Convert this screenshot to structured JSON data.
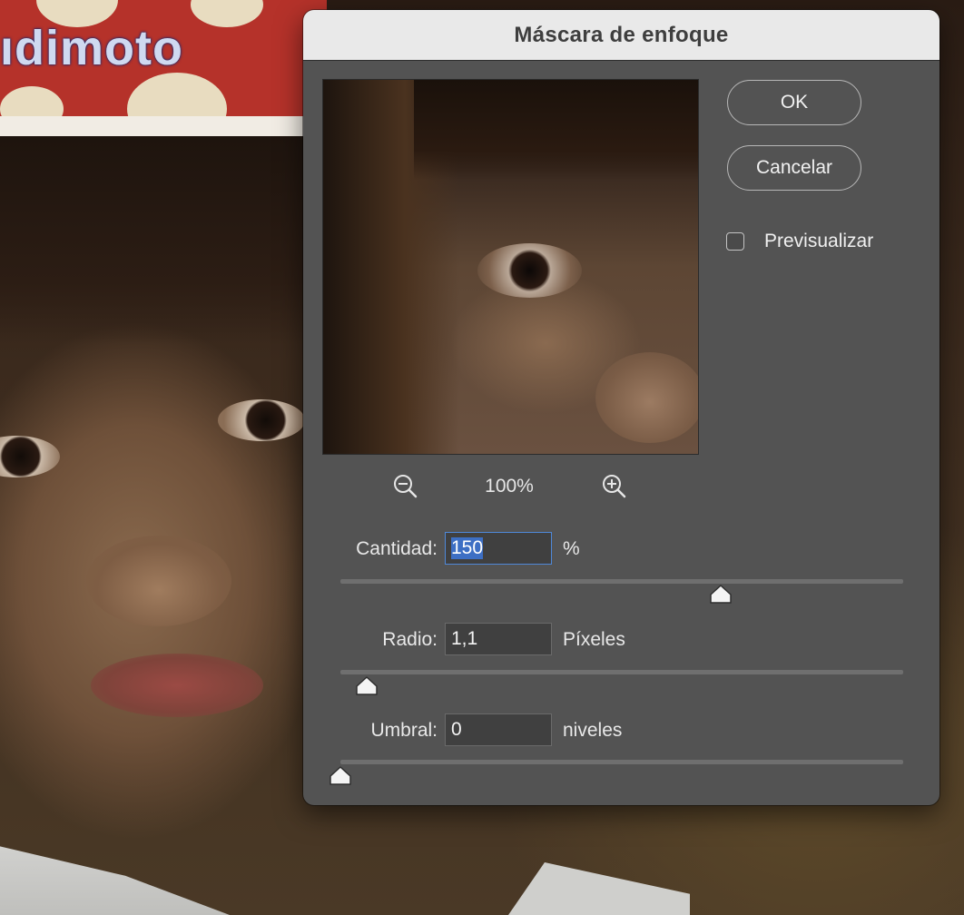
{
  "dialog": {
    "title": "Máscara de enfoque",
    "ok_label": "OK",
    "cancel_label": "Cancelar",
    "preview_label": "Previsualizar",
    "preview_checked": false,
    "zoom": {
      "level": "100%",
      "zoom_out_icon": "zoom-out-icon",
      "zoom_in_icon": "zoom-in-icon"
    },
    "params": {
      "amount": {
        "label": "Cantidad:",
        "value": "150",
        "unit": "%",
        "fraction": 0.675
      },
      "radius": {
        "label": "Radio:",
        "value": "1,1",
        "unit": "Píxeles",
        "fraction": 0.047
      },
      "threshold": {
        "label": "Umbral:",
        "value": "0",
        "unit": "niveles",
        "fraction": 0.0
      }
    }
  },
  "background": {
    "cap_text": "ıdimoto"
  },
  "colors": {
    "dialog_bg": "#535353",
    "titlebar_bg": "#e9e9e9",
    "focus_blue": "#4f88d8",
    "selection_blue": "#3d6fc4"
  }
}
